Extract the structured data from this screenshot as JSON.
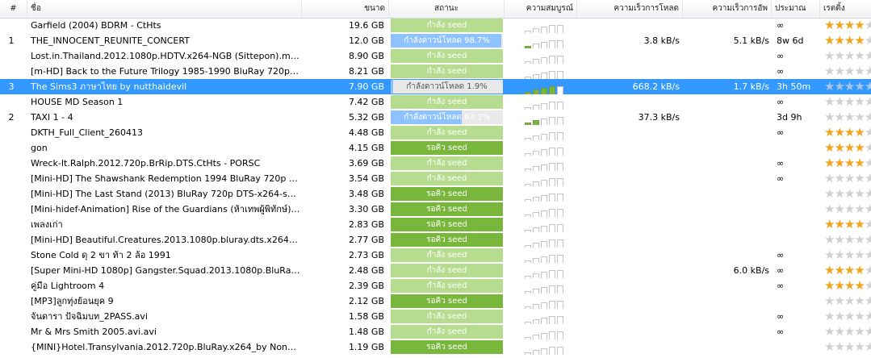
{
  "colors": {
    "seed_light": "#b6dd8f",
    "seed_dark": "#79b73c",
    "downloading": "#8fc3ff",
    "downloading_bg": "#e9e9e9",
    "selected_row": "#3399ff",
    "avail_on": "#7cb342",
    "star_on": "#f2a31b",
    "star_off": "#d0d0d0"
  },
  "columns": {
    "num": "#",
    "name": "ชื่อ",
    "size": "ขนาด",
    "status": "สถานะ",
    "availability": "ความสมบูรณ์",
    "down_speed": "ความเร็วการโหลด",
    "up_speed": "ความเร็วการอัพ",
    "eta": "ประมาณ",
    "rating": "เรตติ้ง"
  },
  "rows": [
    {
      "num": "",
      "name": "Garfield (2004) BDRM - CtHts",
      "size": "19.6 GB",
      "status": "กำลัง seed",
      "status_kind": "seed_light",
      "progress": 1,
      "avail": 0,
      "dl": "",
      "ul": "",
      "eta": "∞",
      "rating": 4
    },
    {
      "num": "1",
      "name": "THE_INNOCENT_REUNITE_CONCERT",
      "size": "12.0 GB",
      "status": "กำลังดาวน์โหลด 98.7%",
      "status_kind": "downloading",
      "progress": 0.987,
      "avail": 1,
      "dl": "3.8 kB/s",
      "ul": "5.1 kB/s",
      "eta": "8w 6d",
      "rating": 4
    },
    {
      "num": "",
      "name": "Lost.in.Thailand.2012.1080p.HDTV.x264-NGB (Sittepon).mkv",
      "size": "8.90 GB",
      "status": "กำลัง seed",
      "status_kind": "seed_light",
      "progress": 1,
      "avail": 0,
      "dl": "",
      "ul": "",
      "eta": "∞",
      "rating": 0
    },
    {
      "num": "",
      "name": "[m-HD] Back to the Future Trilogy 1985-1990 BluRay 720p AC...",
      "size": "8.21 GB",
      "status": "กำลัง seed",
      "status_kind": "seed_light",
      "progress": 1,
      "avail": 0,
      "dl": "",
      "ul": "",
      "eta": "∞",
      "rating": 0
    },
    {
      "num": "3",
      "name": "The Sims3 ภาษาไทย by nutthaidevil",
      "size": "7.90 GB",
      "status": "กำลังดาวน์โหลด 1.9%",
      "status_kind": "downloading",
      "progress": 0.019,
      "avail": 4,
      "dl": "668.2 kB/s",
      "ul": "1.7 kB/s",
      "eta": "3h 50m",
      "rating": 0,
      "selected": true
    },
    {
      "num": "",
      "name": "HOUSE MD Season 1",
      "size": "7.42 GB",
      "status": "กำลัง seed",
      "status_kind": "seed_light",
      "progress": 1,
      "avail": 0,
      "dl": "",
      "ul": "",
      "eta": "∞",
      "rating": 0
    },
    {
      "num": "2",
      "name": "TAXI 1 - 4",
      "size": "5.32 GB",
      "status": "กำลังดาวน์โหลด 63.3%",
      "status_kind": "downloading",
      "progress": 0.633,
      "avail": 2,
      "dl": "37.3 kB/s",
      "ul": "",
      "eta": "3d 9h",
      "rating": 0
    },
    {
      "num": "",
      "name": "DKTH_Full_Client_260413",
      "size": "4.48 GB",
      "status": "กำลัง seed",
      "status_kind": "seed_light",
      "progress": 1,
      "avail": 0,
      "dl": "",
      "ul": "",
      "eta": "∞",
      "rating": 4
    },
    {
      "num": "",
      "name": "gon",
      "size": "4.15 GB",
      "status": "รอคิว seed",
      "status_kind": "seed_dark",
      "progress": 1,
      "avail": 0,
      "dl": "",
      "ul": "",
      "eta": "",
      "rating": 4
    },
    {
      "num": "",
      "name": "Wreck-It.Ralph.2012.720p.BrRip.DTS.CtHts - PORSC",
      "size": "3.69 GB",
      "status": "กำลัง seed",
      "status_kind": "seed_light",
      "progress": 1,
      "avail": 0,
      "dl": "",
      "ul": "",
      "eta": "∞",
      "rating": 4
    },
    {
      "num": "",
      "name": "[Mini-HD] The Shawshank Redemption 1994 BluRay 720p AC...",
      "size": "3.54 GB",
      "status": "กำลัง seed",
      "status_kind": "seed_light",
      "progress": 1,
      "avail": 0,
      "dl": "",
      "ul": "",
      "eta": "∞",
      "rating": 0
    },
    {
      "num": "",
      "name": "[Mini-HD] The Last Stand (2013) BluRay 720p DTS-x264-softer...",
      "size": "3.48 GB",
      "status": "รอคิว seed",
      "status_kind": "seed_dark",
      "progress": 1,
      "avail": 0,
      "dl": "",
      "ul": "",
      "eta": "",
      "rating": 0
    },
    {
      "num": "",
      "name": "[Mini-hidef-Animation] Rise of the Guardians (ห้าเทพผู้พิทักษ์) ...",
      "size": "3.30 GB",
      "status": "รอคิว seed",
      "status_kind": "seed_dark",
      "progress": 1,
      "avail": 0,
      "dl": "",
      "ul": "",
      "eta": "",
      "rating": 0
    },
    {
      "num": "",
      "name": "เพลงเก่า",
      "size": "2.83 GB",
      "status": "รอคิว seed",
      "status_kind": "seed_dark",
      "progress": 1,
      "avail": 0,
      "dl": "",
      "ul": "",
      "eta": "",
      "rating": 4
    },
    {
      "num": "",
      "name": "[Mini-HD] Beautiful.Creatures.2013.1080p.bluray.dts.x264.mkv",
      "size": "2.77 GB",
      "status": "รอคิว seed",
      "status_kind": "seed_dark",
      "progress": 1,
      "avail": 0,
      "dl": "",
      "ul": "",
      "eta": "",
      "rating": 0
    },
    {
      "num": "",
      "name": "Stone Cold  ดุ 2 ขา ท้า 2 ล้อ  1991",
      "size": "2.73 GB",
      "status": "กำลัง seed",
      "status_kind": "seed_light",
      "progress": 1,
      "avail": 0,
      "dl": "",
      "ul": "",
      "eta": "∞",
      "rating": 0
    },
    {
      "num": "",
      "name": "[Super Mini-HD 1080p] Gangster.Squad.2013.1080p.BluRay.x2...",
      "size": "2.48 GB",
      "status": "กำลัง seed",
      "status_kind": "seed_light",
      "progress": 1,
      "avail": 0,
      "dl": "",
      "ul": "6.0 kB/s",
      "eta": "∞",
      "rating": 4
    },
    {
      "num": "",
      "name": "คู่มือ Lightroom 4",
      "size": "2.39 GB",
      "status": "กำลัง seed",
      "status_kind": "seed_light",
      "progress": 1,
      "avail": 0,
      "dl": "",
      "ul": "",
      "eta": "∞",
      "rating": 4
    },
    {
      "num": "",
      "name": "[MP3]ลูกทุ่งย้อนยุค 9",
      "size": "2.12 GB",
      "status": "รอคิว seed",
      "status_kind": "seed_dark",
      "progress": 1,
      "avail": 0,
      "dl": "",
      "ul": "",
      "eta": "",
      "rating": 0
    },
    {
      "num": "",
      "name": "จันดารา ปัจฉิมบท_2PASS.avi",
      "size": "1.58 GB",
      "status": "กำลัง seed",
      "status_kind": "seed_light",
      "progress": 1,
      "avail": 0,
      "dl": "",
      "ul": "",
      "eta": "∞",
      "rating": 0
    },
    {
      "num": "",
      "name": "Mr & Mrs Smith 2005.avi.avi",
      "size": "1.48 GB",
      "status": "กำลัง seed",
      "status_kind": "seed_light",
      "progress": 1,
      "avail": 0,
      "dl": "",
      "ul": "",
      "eta": "∞",
      "rating": 0
    },
    {
      "num": "",
      "name": "{MINI}Hotel.Transylvania.2012.720p.BluRay.x264_by NongZEZ...",
      "size": "1.19 GB",
      "status": "รอคิว seed",
      "status_kind": "seed_dark",
      "progress": 1,
      "avail": 0,
      "dl": "",
      "ul": "",
      "eta": "",
      "rating": 0
    }
  ]
}
